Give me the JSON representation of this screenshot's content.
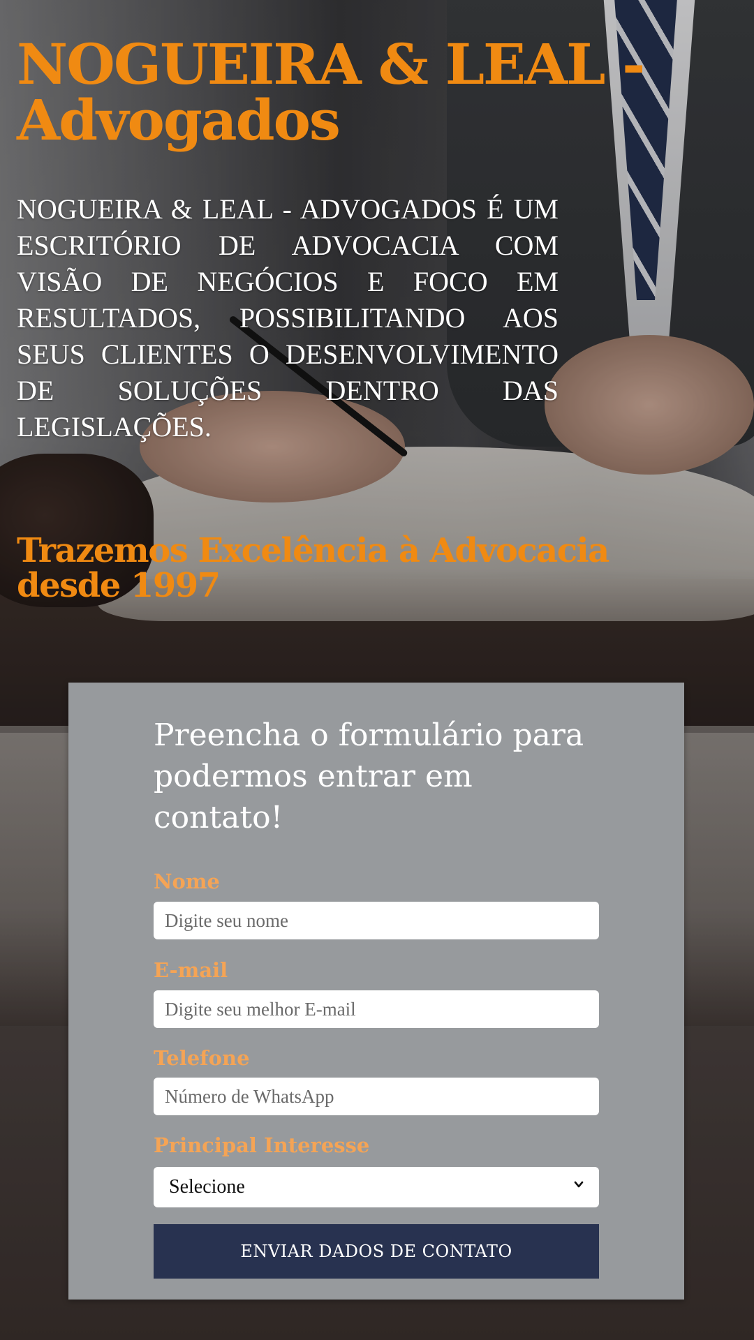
{
  "hero": {
    "brand_line1": "NOGUEIRA & LEAL -",
    "brand_line2": "Advogados",
    "about": "NOGUEIRA & LEAL - ADVOGADOS É UM ESCRITÓRIO DE ADVOCACIA COM VISÃO DE NEGÓCIOS E FOCO EM RESULTADOS, POSSIBILITANDO AOS SEUS CLIENTES O DESENVOLVIMENTO DE SOLUÇÕES DENTRO DAS LEGISLAÇÕES.",
    "tagline": "Trazemos Excelência à Advocacia desde 1997"
  },
  "form": {
    "title": "Preencha o formulário para podermos entrar em contato!",
    "name_label": "Nome",
    "name_placeholder": "Digite seu nome",
    "email_label": "E-mail",
    "email_placeholder": "Digite seu melhor E-mail",
    "phone_label": "Telefone",
    "phone_placeholder": "Número de WhatsApp",
    "interest_label": "Principal Interesse",
    "interest_selected": "Selecione",
    "submit_label": "ENVIAR DADOS DE CONTATO"
  },
  "colors": {
    "brand_orange": "#f08a12",
    "label_orange": "#f5a455",
    "card_gray": "#979a9d",
    "button_navy": "#283250"
  }
}
